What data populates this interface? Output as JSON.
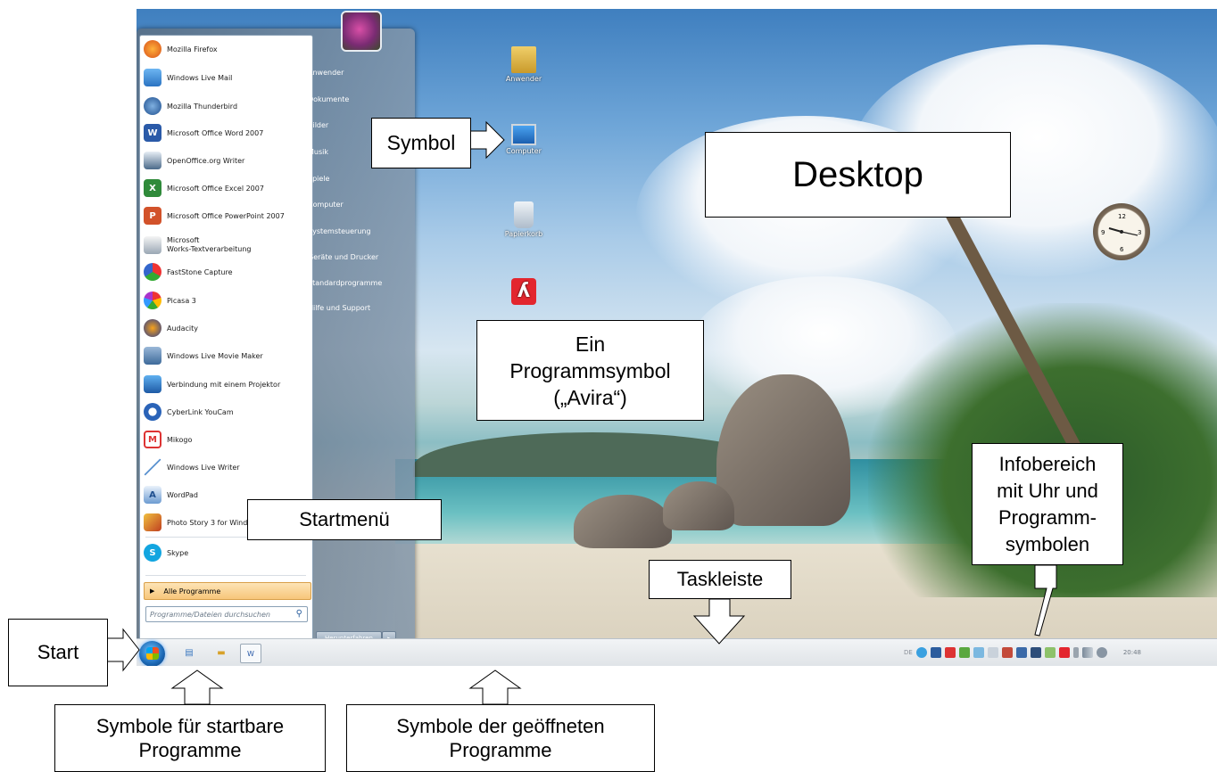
{
  "start_menu": {
    "programs": [
      {
        "label": "Mozilla Firefox",
        "icon": "firefox-icon"
      },
      {
        "label": "Windows Live Mail",
        "icon": "mail-icon"
      },
      {
        "label": "Mozilla Thunderbird",
        "icon": "thunderbird-icon"
      },
      {
        "label": "Microsoft Office Word 2007",
        "icon": "word-icon"
      },
      {
        "label": "OpenOffice.org Writer",
        "icon": "writer-icon"
      },
      {
        "label": "Microsoft Office Excel 2007",
        "icon": "excel-icon"
      },
      {
        "label": "Microsoft Office PowerPoint 2007",
        "icon": "powerpoint-icon"
      },
      {
        "label": "Microsoft",
        "label2": "Works-Textverarbeitung",
        "icon": "works-icon"
      },
      {
        "label": "FastStone Capture",
        "icon": "faststone-icon"
      },
      {
        "label": "Picasa 3",
        "icon": "picasa-icon"
      },
      {
        "label": "Audacity",
        "icon": "audacity-icon"
      },
      {
        "label": "Windows Live Movie Maker",
        "icon": "moviemaker-icon"
      },
      {
        "label": "Verbindung mit einem Projektor",
        "icon": "projector-icon"
      },
      {
        "label": "CyberLink YouCam",
        "icon": "youcam-icon"
      },
      {
        "label": "Mikogo",
        "icon": "mikogo-icon"
      },
      {
        "label": "Windows Live Writer",
        "icon": "livewriter-icon"
      },
      {
        "label": "WordPad",
        "icon": "wordpad-icon"
      },
      {
        "label": "Photo Story 3 for Windows",
        "icon": "photostory-icon"
      },
      {
        "label": "Skype",
        "icon": "skype-icon"
      }
    ],
    "all_programs": "Alle Programme",
    "search_placeholder": "Programme/Dateien durchsuchen",
    "right_items": [
      "Anwender",
      "Dokumente",
      "Bilder",
      "Musik",
      "Spiele",
      "Computer",
      "Systemsteuerung",
      "Geräte und Drucker",
      "Standardprogramme",
      "Hilfe und Support"
    ],
    "shutdown_label": "Herunterfahren"
  },
  "desktop_icons": [
    {
      "label": "Anwender",
      "icon": "user-folder-icon"
    },
    {
      "label": "Computer",
      "icon": "computer-icon"
    },
    {
      "label": "Papierkorb",
      "icon": "recycle-bin-icon"
    },
    {
      "label": "",
      "icon": "avira-icon"
    }
  ],
  "taskbar": {
    "language": "DE",
    "time": "20:48",
    "colors": {
      "orb": "#1b67b4",
      "avira": "#e3262e"
    }
  },
  "callouts": {
    "symbol": "Symbol",
    "desktop": "Desktop",
    "program_symbol": [
      "Ein",
      "Programmsymbol",
      "(„Avira“)"
    ],
    "startmenu": "Startmenü",
    "infobereich": [
      "Infobereich",
      "mit Uhr und",
      "Programm-",
      "symbolen"
    ],
    "taskleiste": "Taskleiste",
    "start": "Start",
    "startable": [
      "Symbole für startbare",
      "Programme"
    ],
    "opened": [
      "Symbole der geöffneten",
      "Programme"
    ]
  }
}
